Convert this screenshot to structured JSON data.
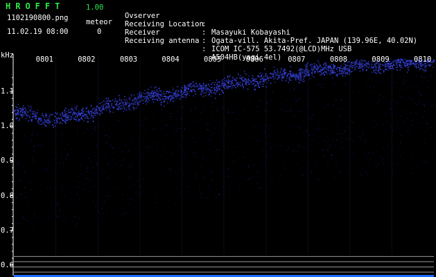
{
  "header": {
    "app_title": "HROFFT",
    "app_version": "1.00",
    "file_name": "1102190800.png",
    "meteor_label": "meteor",
    "timestamp": "11.02.19 08:00",
    "meteor_count": "0"
  },
  "info": [
    {
      "label": "Ovserver",
      "value": "Masayuki Kobayashi"
    },
    {
      "label": "Receiving Location",
      "value": "Ogata-vill. Akita-Pref. JAPAN (139.96E, 40.02N)"
    },
    {
      "label": "Receiver",
      "value": "ICOM IC-575 53.7492(@LCD)MHz USB"
    },
    {
      "label": "Receiving antenna",
      "value": "A504HB(yagi 4el)"
    }
  ],
  "colors": {
    "title_green": "#2fe84a",
    "background": "#000000",
    "signal_blue": "#3a3aff",
    "text": "#ffffff",
    "reference_line": "#9a9a9a"
  },
  "chart_data": {
    "type": "heatmap",
    "xlabel": "",
    "ylabel": "kHz",
    "x_ticks": [
      "0801",
      "0802",
      "0803",
      "0804",
      "0805",
      "0806",
      "0807",
      "0808",
      "0809",
      "0810"
    ],
    "y_ticks": [
      "1.1",
      "1.0",
      "0.9",
      "0.8",
      "0.7",
      "0.6"
    ],
    "ylim": [
      0.57,
      1.2
    ],
    "xlim": [
      0,
      10
    ],
    "reference_lines_khz": [
      0.625,
      0.61,
      0.595,
      0.58
    ],
    "signal_track": {
      "x": [
        0,
        1,
        2,
        3,
        4,
        5,
        6,
        7,
        8,
        9,
        10
      ],
      "center_khz": [
        1.04,
        1.02,
        1.05,
        1.08,
        1.1,
        1.12,
        1.14,
        1.16,
        1.17,
        1.18,
        1.19
      ],
      "spread_khz": 0.035
    }
  }
}
